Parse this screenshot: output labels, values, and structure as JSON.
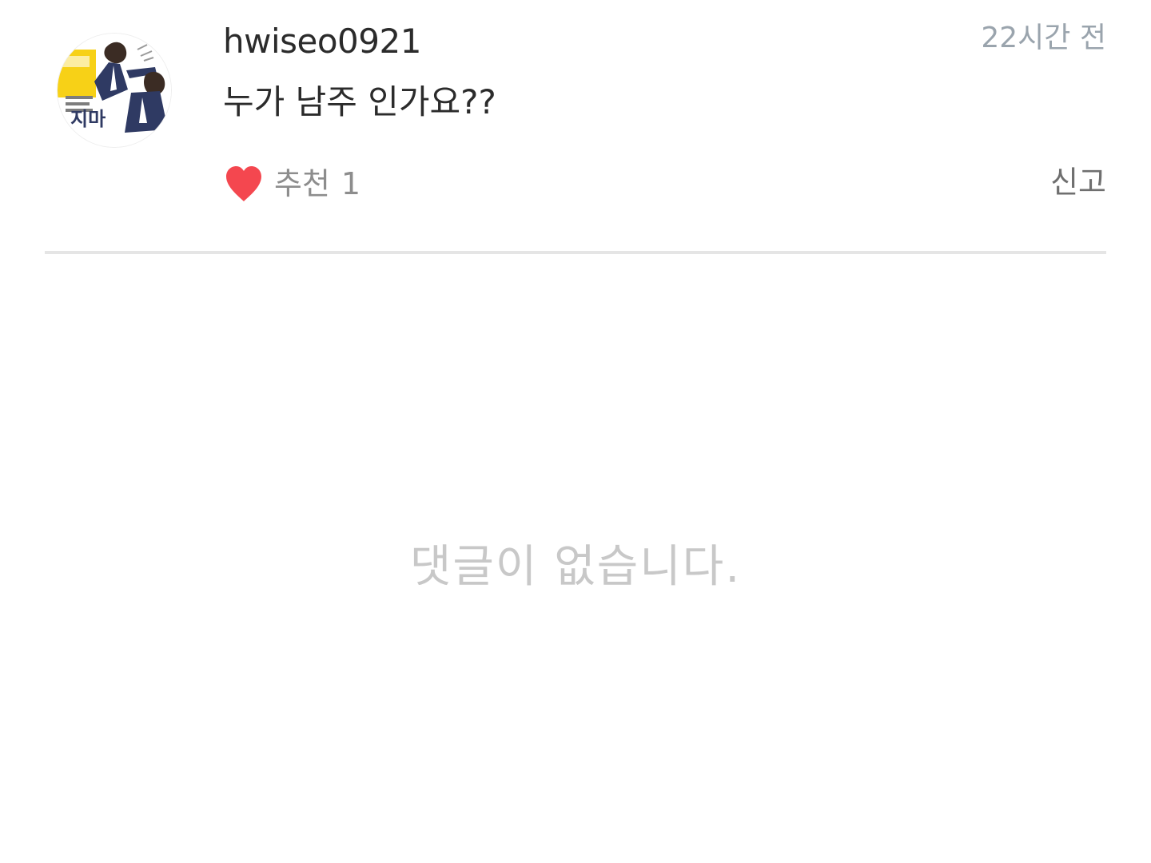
{
  "post": {
    "author": {
      "username": "hwiseo0921",
      "avatar_icon": "avatar-illustration",
      "avatar_label": "지마"
    },
    "timestamp": "22시간 전",
    "content": "누가 남주 인가요??",
    "like": {
      "icon": "heart-icon",
      "color": "#f4474f",
      "label": "추천",
      "count": "1"
    },
    "report_label": "신고"
  },
  "comments": {
    "empty_message": "댓글이 없습니다."
  }
}
